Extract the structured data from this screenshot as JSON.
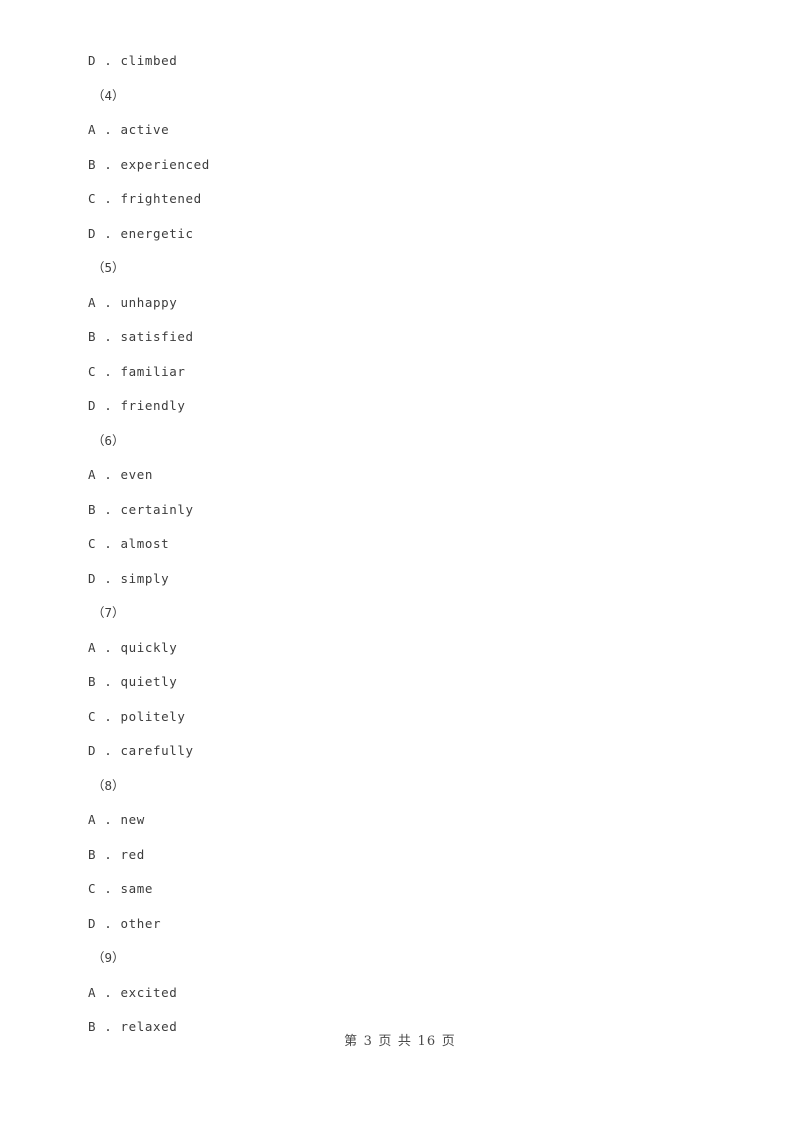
{
  "document": {
    "page_background": "#ffffff",
    "text_color": "#3c3c3c",
    "blocks": [
      {
        "kind": "option",
        "text": "D . climbed"
      },
      {
        "kind": "qnum",
        "text": "（4）"
      },
      {
        "kind": "option",
        "text": "A . active"
      },
      {
        "kind": "option",
        "text": "B . experienced"
      },
      {
        "kind": "option",
        "text": "C . frightened"
      },
      {
        "kind": "option",
        "text": "D . energetic"
      },
      {
        "kind": "qnum",
        "text": "（5）"
      },
      {
        "kind": "option",
        "text": "A . unhappy"
      },
      {
        "kind": "option",
        "text": "B . satisfied"
      },
      {
        "kind": "option",
        "text": "C . familiar"
      },
      {
        "kind": "option",
        "text": "D . friendly"
      },
      {
        "kind": "qnum",
        "text": "（6）"
      },
      {
        "kind": "option",
        "text": "A . even"
      },
      {
        "kind": "option",
        "text": "B . certainly"
      },
      {
        "kind": "option",
        "text": "C . almost"
      },
      {
        "kind": "option",
        "text": "D . simply"
      },
      {
        "kind": "qnum",
        "text": "（7）"
      },
      {
        "kind": "option",
        "text": "A . quickly"
      },
      {
        "kind": "option",
        "text": "B . quietly"
      },
      {
        "kind": "option",
        "text": "C . politely"
      },
      {
        "kind": "option",
        "text": "D . carefully"
      },
      {
        "kind": "qnum",
        "text": "（8）"
      },
      {
        "kind": "option",
        "text": "A . new"
      },
      {
        "kind": "option",
        "text": "B . red"
      },
      {
        "kind": "option",
        "text": "C . same"
      },
      {
        "kind": "option",
        "text": "D . other"
      },
      {
        "kind": "qnum",
        "text": "（9）"
      },
      {
        "kind": "option",
        "text": "A . excited"
      },
      {
        "kind": "option",
        "text": "B . relaxed"
      }
    ],
    "footer": {
      "text": "第 3 页 共 16 页",
      "current_page": "3",
      "total_pages": "16"
    }
  }
}
